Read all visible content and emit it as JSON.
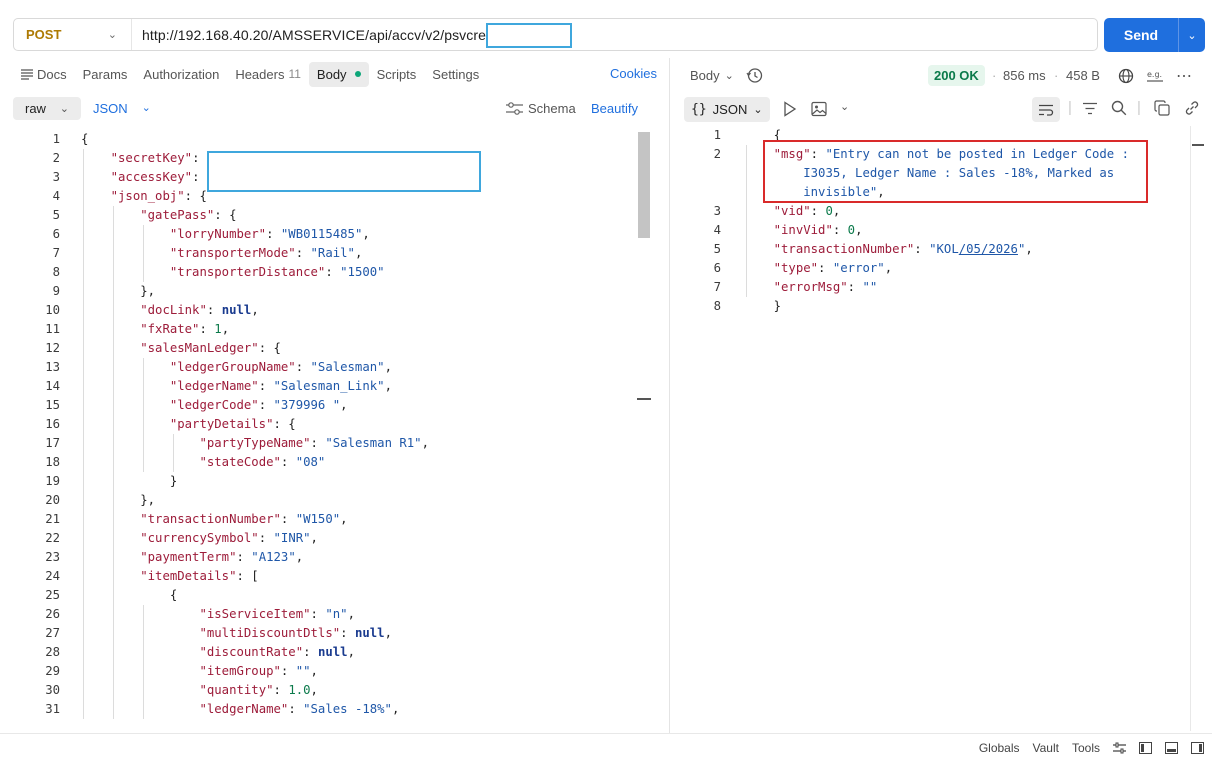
{
  "request": {
    "method": "POST",
    "url": "http://192.168.40.20/AMSSERVICE/api/accv/v2/psvcreate",
    "send_label": "Send"
  },
  "tabs": [
    {
      "label": "Docs"
    },
    {
      "label": "Params"
    },
    {
      "label": "Authorization"
    },
    {
      "label": "Headers",
      "count": "11"
    },
    {
      "label": "Body"
    },
    {
      "label": "Scripts"
    },
    {
      "label": "Settings"
    }
  ],
  "cookies_label": "Cookies",
  "body_toolbar": {
    "mode": "raw",
    "language": "JSON",
    "schema_label": "Schema",
    "beautify_label": "Beautify"
  },
  "request_body": [
    {
      "n": "1",
      "indent": 0,
      "parts": [
        [
          "p",
          "{"
        ]
      ]
    },
    {
      "n": "2",
      "indent": 1,
      "parts": [
        [
          "k",
          "\"secretKey\""
        ],
        [
          "p",
          ":"
        ]
      ]
    },
    {
      "n": "3",
      "indent": 1,
      "parts": [
        [
          "k",
          "\"accessKey\""
        ],
        [
          "p",
          ":"
        ]
      ]
    },
    {
      "n": "4",
      "indent": 1,
      "parts": [
        [
          "k",
          "\"json_obj\""
        ],
        [
          "p",
          ": {"
        ]
      ]
    },
    {
      "n": "5",
      "indent": 2,
      "parts": [
        [
          "k",
          "\"gatePass\""
        ],
        [
          "p",
          ": {"
        ]
      ]
    },
    {
      "n": "6",
      "indent": 3,
      "parts": [
        [
          "k",
          "\"lorryNumber\""
        ],
        [
          "p",
          ": "
        ],
        [
          "s",
          "\"WB0115485\""
        ],
        [
          "p",
          ","
        ]
      ]
    },
    {
      "n": "7",
      "indent": 3,
      "parts": [
        [
          "k",
          "\"transporterMode\""
        ],
        [
          "p",
          ": "
        ],
        [
          "s",
          "\"Rail\""
        ],
        [
          "p",
          ","
        ]
      ]
    },
    {
      "n": "8",
      "indent": 3,
      "parts": [
        [
          "k",
          "\"transporterDistance\""
        ],
        [
          "p",
          ": "
        ],
        [
          "s",
          "\"1500\""
        ]
      ]
    },
    {
      "n": "9",
      "indent": 2,
      "parts": [
        [
          "p",
          "},"
        ]
      ]
    },
    {
      "n": "10",
      "indent": 2,
      "parts": [
        [
          "k",
          "\"docLink\""
        ],
        [
          "p",
          ": "
        ],
        [
          "b",
          "null"
        ],
        [
          "p",
          ","
        ]
      ]
    },
    {
      "n": "11",
      "indent": 2,
      "parts": [
        [
          "k",
          "\"fxRate\""
        ],
        [
          "p",
          ": "
        ],
        [
          "n",
          "1"
        ],
        [
          "p",
          ","
        ]
      ]
    },
    {
      "n": "12",
      "indent": 2,
      "parts": [
        [
          "k",
          "\"salesManLedger\""
        ],
        [
          "p",
          ": {"
        ]
      ]
    },
    {
      "n": "13",
      "indent": 3,
      "parts": [
        [
          "k",
          "\"ledgerGroupName\""
        ],
        [
          "p",
          ": "
        ],
        [
          "s",
          "\"Salesman\""
        ],
        [
          "p",
          ","
        ]
      ]
    },
    {
      "n": "14",
      "indent": 3,
      "parts": [
        [
          "k",
          "\"ledgerName\""
        ],
        [
          "p",
          ": "
        ],
        [
          "s",
          "\"Salesman_Link\""
        ],
        [
          "p",
          ","
        ]
      ]
    },
    {
      "n": "15",
      "indent": 3,
      "parts": [
        [
          "k",
          "\"ledgerCode\""
        ],
        [
          "p",
          ": "
        ],
        [
          "s",
          "\"379996 \""
        ],
        [
          "p",
          ","
        ]
      ]
    },
    {
      "n": "16",
      "indent": 3,
      "parts": [
        [
          "k",
          "\"partyDetails\""
        ],
        [
          "p",
          ": {"
        ]
      ]
    },
    {
      "n": "17",
      "indent": 4,
      "parts": [
        [
          "k",
          "\"partyTypeName\""
        ],
        [
          "p",
          ": "
        ],
        [
          "s",
          "\"Salesman R1\""
        ],
        [
          "p",
          ","
        ]
      ]
    },
    {
      "n": "18",
      "indent": 4,
      "parts": [
        [
          "k",
          "\"stateCode\""
        ],
        [
          "p",
          ": "
        ],
        [
          "s",
          "\"08\""
        ]
      ]
    },
    {
      "n": "19",
      "indent": 3,
      "parts": [
        [
          "p",
          "}"
        ]
      ]
    },
    {
      "n": "20",
      "indent": 2,
      "parts": [
        [
          "p",
          "},"
        ]
      ]
    },
    {
      "n": "21",
      "indent": 2,
      "parts": [
        [
          "k",
          "\"transactionNumber\""
        ],
        [
          "p",
          ": "
        ],
        [
          "s",
          "\"W150\""
        ],
        [
          "p",
          ","
        ]
      ]
    },
    {
      "n": "22",
      "indent": 2,
      "parts": [
        [
          "k",
          "\"currencySymbol\""
        ],
        [
          "p",
          ": "
        ],
        [
          "s",
          "\"INR\""
        ],
        [
          "p",
          ","
        ]
      ]
    },
    {
      "n": "23",
      "indent": 2,
      "parts": [
        [
          "k",
          "\"paymentTerm\""
        ],
        [
          "p",
          ": "
        ],
        [
          "s",
          "\"A123\""
        ],
        [
          "p",
          ","
        ]
      ]
    },
    {
      "n": "24",
      "indent": 2,
      "parts": [
        [
          "k",
          "\"itemDetails\""
        ],
        [
          "p",
          ": ["
        ]
      ]
    },
    {
      "n": "25",
      "indent": 3,
      "parts": [
        [
          "p",
          "{"
        ]
      ]
    },
    {
      "n": "26",
      "indent": 4,
      "parts": [
        [
          "k",
          "\"isServiceItem\""
        ],
        [
          "p",
          ": "
        ],
        [
          "s",
          "\"n\""
        ],
        [
          "p",
          ","
        ]
      ]
    },
    {
      "n": "27",
      "indent": 4,
      "parts": [
        [
          "k",
          "\"multiDiscountDtls\""
        ],
        [
          "p",
          ": "
        ],
        [
          "b",
          "null"
        ],
        [
          "p",
          ","
        ]
      ]
    },
    {
      "n": "28",
      "indent": 4,
      "parts": [
        [
          "k",
          "\"discountRate\""
        ],
        [
          "p",
          ": "
        ],
        [
          "b",
          "null"
        ],
        [
          "p",
          ","
        ]
      ]
    },
    {
      "n": "29",
      "indent": 4,
      "parts": [
        [
          "k",
          "\"itemGroup\""
        ],
        [
          "p",
          ": "
        ],
        [
          "s",
          "\"\""
        ],
        [
          "p",
          ","
        ]
      ]
    },
    {
      "n": "30",
      "indent": 4,
      "parts": [
        [
          "k",
          "\"quantity\""
        ],
        [
          "p",
          ": "
        ],
        [
          "n",
          "1.0"
        ],
        [
          "p",
          ","
        ]
      ]
    },
    {
      "n": "31",
      "indent": 4,
      "parts": [
        [
          "k",
          "\"ledgerName\""
        ],
        [
          "p",
          ": "
        ],
        [
          "s",
          "\"Sales -18%\""
        ],
        [
          "p",
          ","
        ]
      ]
    }
  ],
  "response": {
    "body_label": "Body",
    "status": "200 OK",
    "time": "856 ms",
    "size": "458 B",
    "format": "JSON",
    "lines": [
      {
        "n": "1",
        "parts": [
          [
            "p",
            "{"
          ]
        ]
      },
      {
        "n": "2",
        "parts": [
          [
            "k",
            "\"msg\""
          ],
          [
            "p",
            ": "
          ],
          [
            "s",
            "\"Entry can not be posted in Ledger Code :"
          ]
        ]
      },
      {
        "n": "",
        "parts": [
          [
            "s",
            "    I3035, Ledger Name : Sales -18%, Marked as"
          ]
        ]
      },
      {
        "n": "",
        "parts": [
          [
            "s",
            "    invisible\""
          ],
          [
            "p",
            ","
          ]
        ]
      },
      {
        "n": "3",
        "parts": [
          [
            "k",
            "\"vid\""
          ],
          [
            "p",
            ": "
          ],
          [
            "n",
            "0"
          ],
          [
            "p",
            ","
          ]
        ]
      },
      {
        "n": "4",
        "parts": [
          [
            "k",
            "\"invVid\""
          ],
          [
            "p",
            ": "
          ],
          [
            "n",
            "0"
          ],
          [
            "p",
            ","
          ]
        ]
      },
      {
        "n": "5",
        "parts": [
          [
            "k",
            "\"transactionNumber\""
          ],
          [
            "p",
            ": "
          ],
          [
            "s",
            "\"KOL/05/2026\""
          ],
          [
            "p",
            ","
          ]
        ]
      },
      {
        "n": "6",
        "parts": [
          [
            "k",
            "\"type\""
          ],
          [
            "p",
            ": "
          ],
          [
            "s",
            "\"error\""
          ],
          [
            "p",
            ","
          ]
        ]
      },
      {
        "n": "7",
        "parts": [
          [
            "k",
            "\"errorMsg\""
          ],
          [
            "p",
            ": "
          ],
          [
            "s",
            "\"\""
          ]
        ]
      },
      {
        "n": "8",
        "parts": [
          [
            "p",
            "}"
          ]
        ]
      }
    ]
  },
  "footer": {
    "items": [
      "Globals",
      "Vault",
      "Tools"
    ]
  }
}
